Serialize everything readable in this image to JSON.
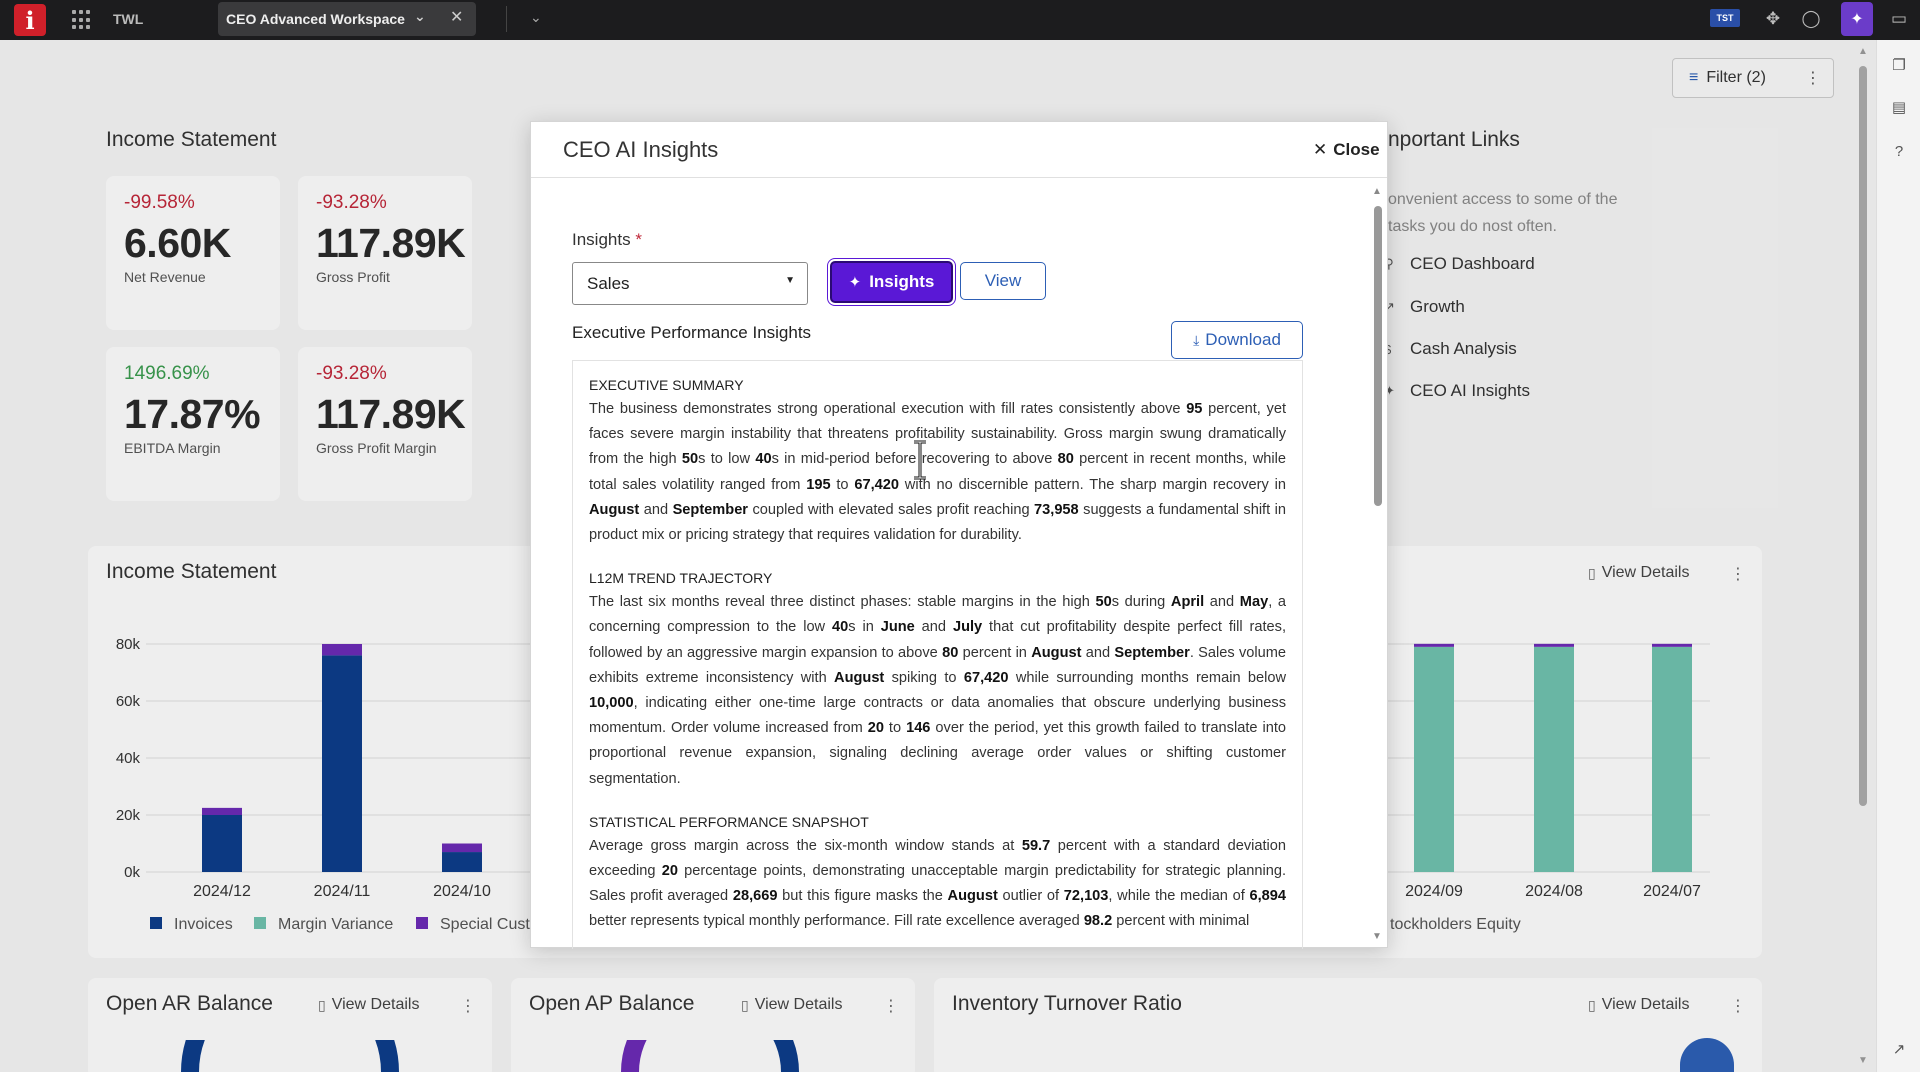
{
  "topbar": {
    "logo": "i",
    "app_name": "TWL",
    "tab_title": "CEO Advanced Workspace",
    "badge": "TST"
  },
  "toolbar": {
    "filter_label": "Filter (2)"
  },
  "kpis": {
    "section_title": "Income Statement",
    "items": [
      {
        "pct": "-99.58%",
        "value": "6.60K",
        "label": "Net Revenue",
        "trend": "down"
      },
      {
        "pct": "-93.28%",
        "value": "117.89K",
        "label": "Gross Profit",
        "trend": "down"
      },
      {
        "pct": "1496.69%",
        "value": "17.87%",
        "label": "EBITDA Margin",
        "trend": "up"
      },
      {
        "pct": "-93.28%",
        "value": "117.89K",
        "label": "Gross Profit Margin",
        "trend": "down"
      }
    ]
  },
  "links": {
    "title": "nportant Links",
    "description": "onvenient access to some of the tasks you do nost often.",
    "items": [
      "CEO Dashboard",
      "Growth",
      "Cash Analysis",
      "CEO AI Insights"
    ]
  },
  "income_chart": {
    "title": "Income Statement",
    "view_details": "View Details",
    "legend": [
      "Invoices",
      "Margin Variance",
      "Special Cust",
      "tockholders Equity"
    ]
  },
  "chart_data": {
    "type": "bar",
    "categories_left": [
      "2024/12",
      "2024/11",
      "2024/10"
    ],
    "categories_right": [
      "2024/09",
      "2024/08",
      "2024/07"
    ],
    "y_ticks": [
      "80k",
      "60k",
      "40k",
      "20k",
      "0k"
    ],
    "ylim": [
      0,
      80000
    ],
    "series": [
      {
        "name": "Invoices",
        "color": "#0d3d8a",
        "values_left": [
          20000,
          76000,
          7000
        ]
      },
      {
        "name": "Special Cust",
        "color": "#6b2bb5",
        "values_left": [
          2500,
          4000,
          3000
        ]
      },
      {
        "name": "Margin Variance",
        "color": "#6fc0ad",
        "values_right": [
          79000,
          79000,
          79000
        ]
      }
    ]
  },
  "bottom_panels": [
    {
      "title": "Open AR Balance",
      "view_details": "View Details"
    },
    {
      "title": "Open AP Balance",
      "view_details": "View Details"
    },
    {
      "title": "Inventory Turnover Ratio",
      "view_details": "View Details"
    }
  ],
  "modal": {
    "title": "CEO AI Insights",
    "close_label": "Close",
    "insights_label": "Insights",
    "required_mark": "*",
    "select_value": "Sales",
    "insights_button": "Insights",
    "view_button": "View",
    "section_heading": "Executive Performance Insights",
    "download_button": "Download",
    "exec_summary_head": "EXECUTIVE SUMMARY",
    "trend_head": "L12M TREND TRAJECTORY",
    "stats_head": "STATISTICAL PERFORMANCE SNAPSHOT",
    "exec_summary_html": "The business demonstrates strong operational execution with fill rates consistently above <b>95</b> percent, yet faces severe margin instability that threatens profitability sustainability. Gross margin swung dramatically from the high <b>50</b>s to low <b>40</b>s in mid-period before recovering to above <b>80</b> percent in recent months, while total sales volatility ranged from <b>195</b> to <b>67,420</b> with no discernible pattern. The sharp margin recovery in <b>August</b> and <b>September</b> coupled with elevated sales profit reaching <b>73,958</b> suggests a fundamental shift in product mix or pricing strategy that requires validation for durability.",
    "trend_html": "The last six months reveal three distinct phases: stable margins in the high <b>50</b>s during <b>April</b> and <b>May</b>, a concerning compression to the low <b>40</b>s in <b>June</b> and <b>July</b> that cut profitability despite perfect fill rates, followed by an aggressive margin expansion to above <b>80</b> percent in <b>August</b> and <b>September</b>. Sales volume exhibits extreme inconsistency with <b>August</b> spiking to <b>67,420</b> while surrounding months remain below <b>10,000</b>, indicating either one-time large contracts or data anomalies that obscure underlying business momentum. Order volume increased from <b>20</b> to <b>146</b> over the period, yet this growth failed to translate into proportional revenue expansion, signaling declining average order values or shifting customer segmentation.",
    "stats_html": "Average gross margin across the six-month window stands at <b>59.7</b> percent with a standard deviation exceeding <b>20</b> percentage points, demonstrating unacceptable margin predictability for strategic planning. Sales profit averaged <b>28,669</b> but this figure masks the <b>August</b> outlier of <b>72,103</b>, while the median of <b>6,894</b> better represents typical monthly performance. Fill rate excellence averaged <b>98.2</b> percent with minimal"
  }
}
